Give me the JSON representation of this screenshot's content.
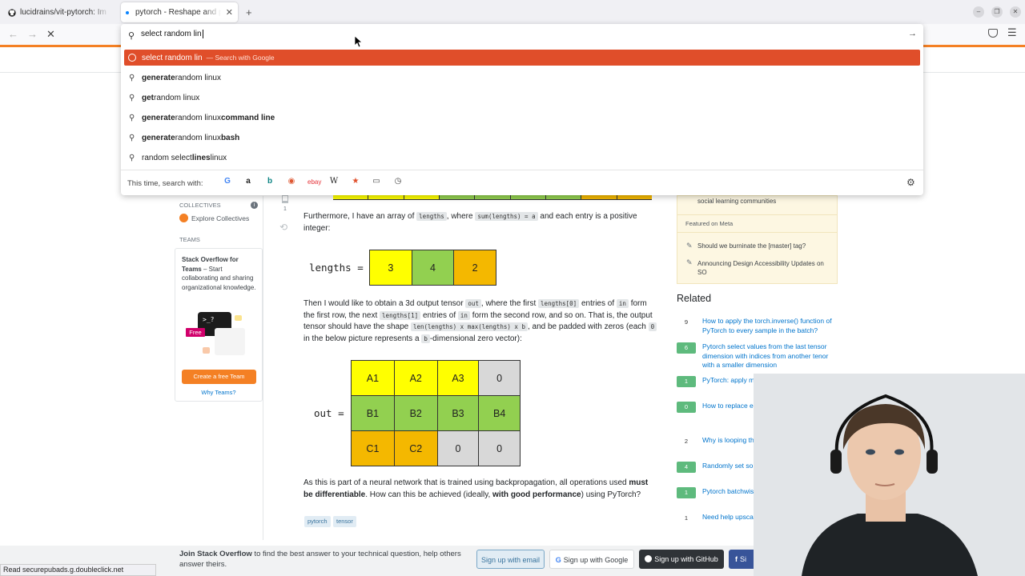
{
  "tabs": [
    {
      "title": "lucidrains/vit-pytorch: Im",
      "icon": "github-icon"
    },
    {
      "title": "pytorch - Reshape and pa",
      "icon": "loading-dot-icon"
    }
  ],
  "urlbar": {
    "typed": "select random lin",
    "highlight": {
      "text": "select random lin",
      "suffix": "— Search with Google"
    },
    "suggestions": [
      {
        "pre": "generate ",
        "plain": "random linux",
        "post": ""
      },
      {
        "pre": "get ",
        "plain": "random linux",
        "post": ""
      },
      {
        "pre": "generate ",
        "plain": "random linux ",
        "post": "command line"
      },
      {
        "pre": "generate ",
        "plain": "random linux ",
        "post": "bash"
      },
      {
        "pre": "",
        "plain": "random select ",
        "post": "lines",
        "tail": " linux"
      }
    ],
    "search_with_label": "This time, search with:"
  },
  "left_sidebar": {
    "collectives_label": "COLLECTIVES",
    "explore_collectives": "Explore Collectives",
    "teams_label": "TEAMS",
    "teams_title": "Stack Overflow for Teams",
    "teams_desc": " – Start collaborating and sharing organizational knowledge.",
    "free_badge": "Free",
    "create_team_button": "Create a free Team",
    "why_teams": "Why Teams?",
    "terminal_prompt": ">_?"
  },
  "question": {
    "vote_count": "1",
    "p1_a": "Furthermore, I have an array of ",
    "p1_code1": "lengths",
    "p1_b": ", where ",
    "p1_code2": "sum(lengths) = a",
    "p1_c": " and each entry is a positive integer:",
    "lengths_label": "lengths =",
    "lengths_values": [
      "3",
      "4",
      "2"
    ],
    "p2_a": "Then I would like to obtain a 3d output tensor ",
    "p2_code1": "out",
    "p2_b": ", where the first ",
    "p2_code2": "lengths[0]",
    "p2_c": " entries of ",
    "p2_code3": "in",
    "p2_d": " form the first row, the next ",
    "p2_code4": "lengths[1]",
    "p2_e": " entries of ",
    "p2_code5": "in",
    "p2_f": " form the second row, and so on. That is, the output tensor should have the shape ",
    "p2_code6": "len(lengths) x max(lengths) x b",
    "p2_g": ", and be padded with zeros (each ",
    "p2_code7": "0",
    "p2_h": " in the below picture represents a ",
    "p2_code8": "b",
    "p2_i": "-dimensional zero vector):",
    "out_label": "out =",
    "out_rows": [
      [
        "A1",
        "A2",
        "A3",
        "0"
      ],
      [
        "B1",
        "B2",
        "B3",
        "B4"
      ],
      [
        "C1",
        "C2",
        "0",
        "0"
      ]
    ],
    "p3_a": "As this is part of a neural network that is trained using backpropagation, all operations used ",
    "p3_bold1": "must be differentiable",
    "p3_b": ". How can this be achieved (ideally, ",
    "p3_bold2": "with good performance",
    "p3_c": ") using PyTorch?",
    "tags": [
      "pytorch",
      "tensor"
    ]
  },
  "meta_box": {
    "item0": "social learning communities",
    "featured_label": "Featured on Meta",
    "items": [
      "Should we burninate the [master] tag?",
      "Announcing Design Accessibility Updates on SO"
    ]
  },
  "related": {
    "heading": "Related",
    "items": [
      {
        "score": "9",
        "answered": false,
        "title": "How to apply the torch.inverse() function of PyTorch to every sample in the batch?"
      },
      {
        "score": "6",
        "answered": true,
        "title": "Pytorch select values from the last tensor dimension with indices from another tenor with a smaller dimension"
      },
      {
        "score": "1",
        "answered": true,
        "title": "PyTorch: apply m dimension of ten"
      },
      {
        "score": "0",
        "answered": true,
        "title": "How to replace e zero with a certa tensor?"
      },
      {
        "score": "2",
        "answered": false,
        "title": "Why is looping th slow (compared"
      },
      {
        "score": "4",
        "answered": true,
        "title": "Randomly set so zero (with low co"
      },
      {
        "score": "1",
        "answered": true,
        "title": "Pytorch batchwis multiplication"
      },
      {
        "score": "1",
        "answered": false,
        "title": "Need help upsca Pytorch tensors"
      }
    ]
  },
  "banner": {
    "bold": "Join Stack Overflow",
    "text": " to find the best answer to your technical question, help others answer theirs.",
    "email_btn": "Sign up with email",
    "google_btn": "Sign up with Google",
    "github_btn": "Sign up with GitHub",
    "fb_btn": "Si"
  },
  "status_bar": "Read securepubads.g.doubleclick.net",
  "colors": {
    "accent": "#e04e2a",
    "so_orange": "#f48024",
    "answered_green": "#5eba7d",
    "link": "#0074cc"
  }
}
